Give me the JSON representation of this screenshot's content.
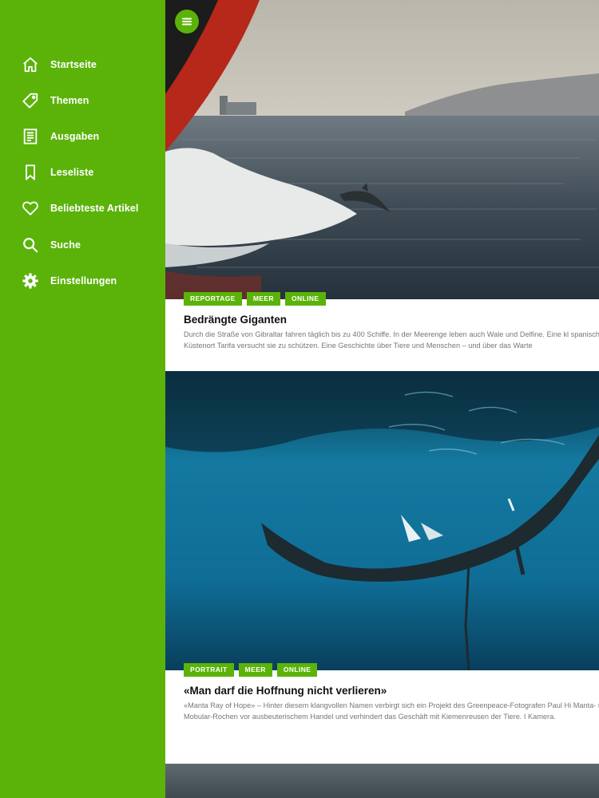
{
  "sidebar": {
    "items": [
      {
        "label": "Startseite",
        "icon": "home-icon"
      },
      {
        "label": "Themen",
        "icon": "tag-icon"
      },
      {
        "label": "Ausgaben",
        "icon": "document-icon"
      },
      {
        "label": "Leseliste",
        "icon": "bookmark-icon"
      },
      {
        "label": "Beliebteste Artikel",
        "icon": "heart-icon"
      },
      {
        "label": "Suche",
        "icon": "search-icon"
      },
      {
        "label": "Einstellungen",
        "icon": "gear-icon"
      }
    ]
  },
  "colors": {
    "accent": "#5bb30a"
  },
  "articles": [
    {
      "tags": [
        "REPORTAGE",
        "MEER",
        "ONLINE"
      ],
      "title": "Bedrängte Giganten",
      "teaser": "Durch die Straße von Gibraltar fahren täglich bis zu 400 Schiffe. In der Meerenge leben auch Wale und Delfine. Eine kl spanischen Küstenort Tarifa versucht sie zu schützen. Eine Geschichte über Tiere und Menschen – und über das Warte"
    },
    {
      "tags": [
        "PORTRAIT",
        "MEER",
        "ONLINE"
      ],
      "title": "«Man darf die Hoffnung nicht verlieren»",
      "teaser": "«Manta Ray of Hope» – Hinter diesem klangvollen Namen verbirgt sich ein Projekt des Greenpeace-Fotografen Paul Hi Manta- und Mobular-Rochen vor ausbeuterischem Handel und verhindert das Geschäft mit Kiemenreusen der Tiere. I Kamera."
    }
  ]
}
